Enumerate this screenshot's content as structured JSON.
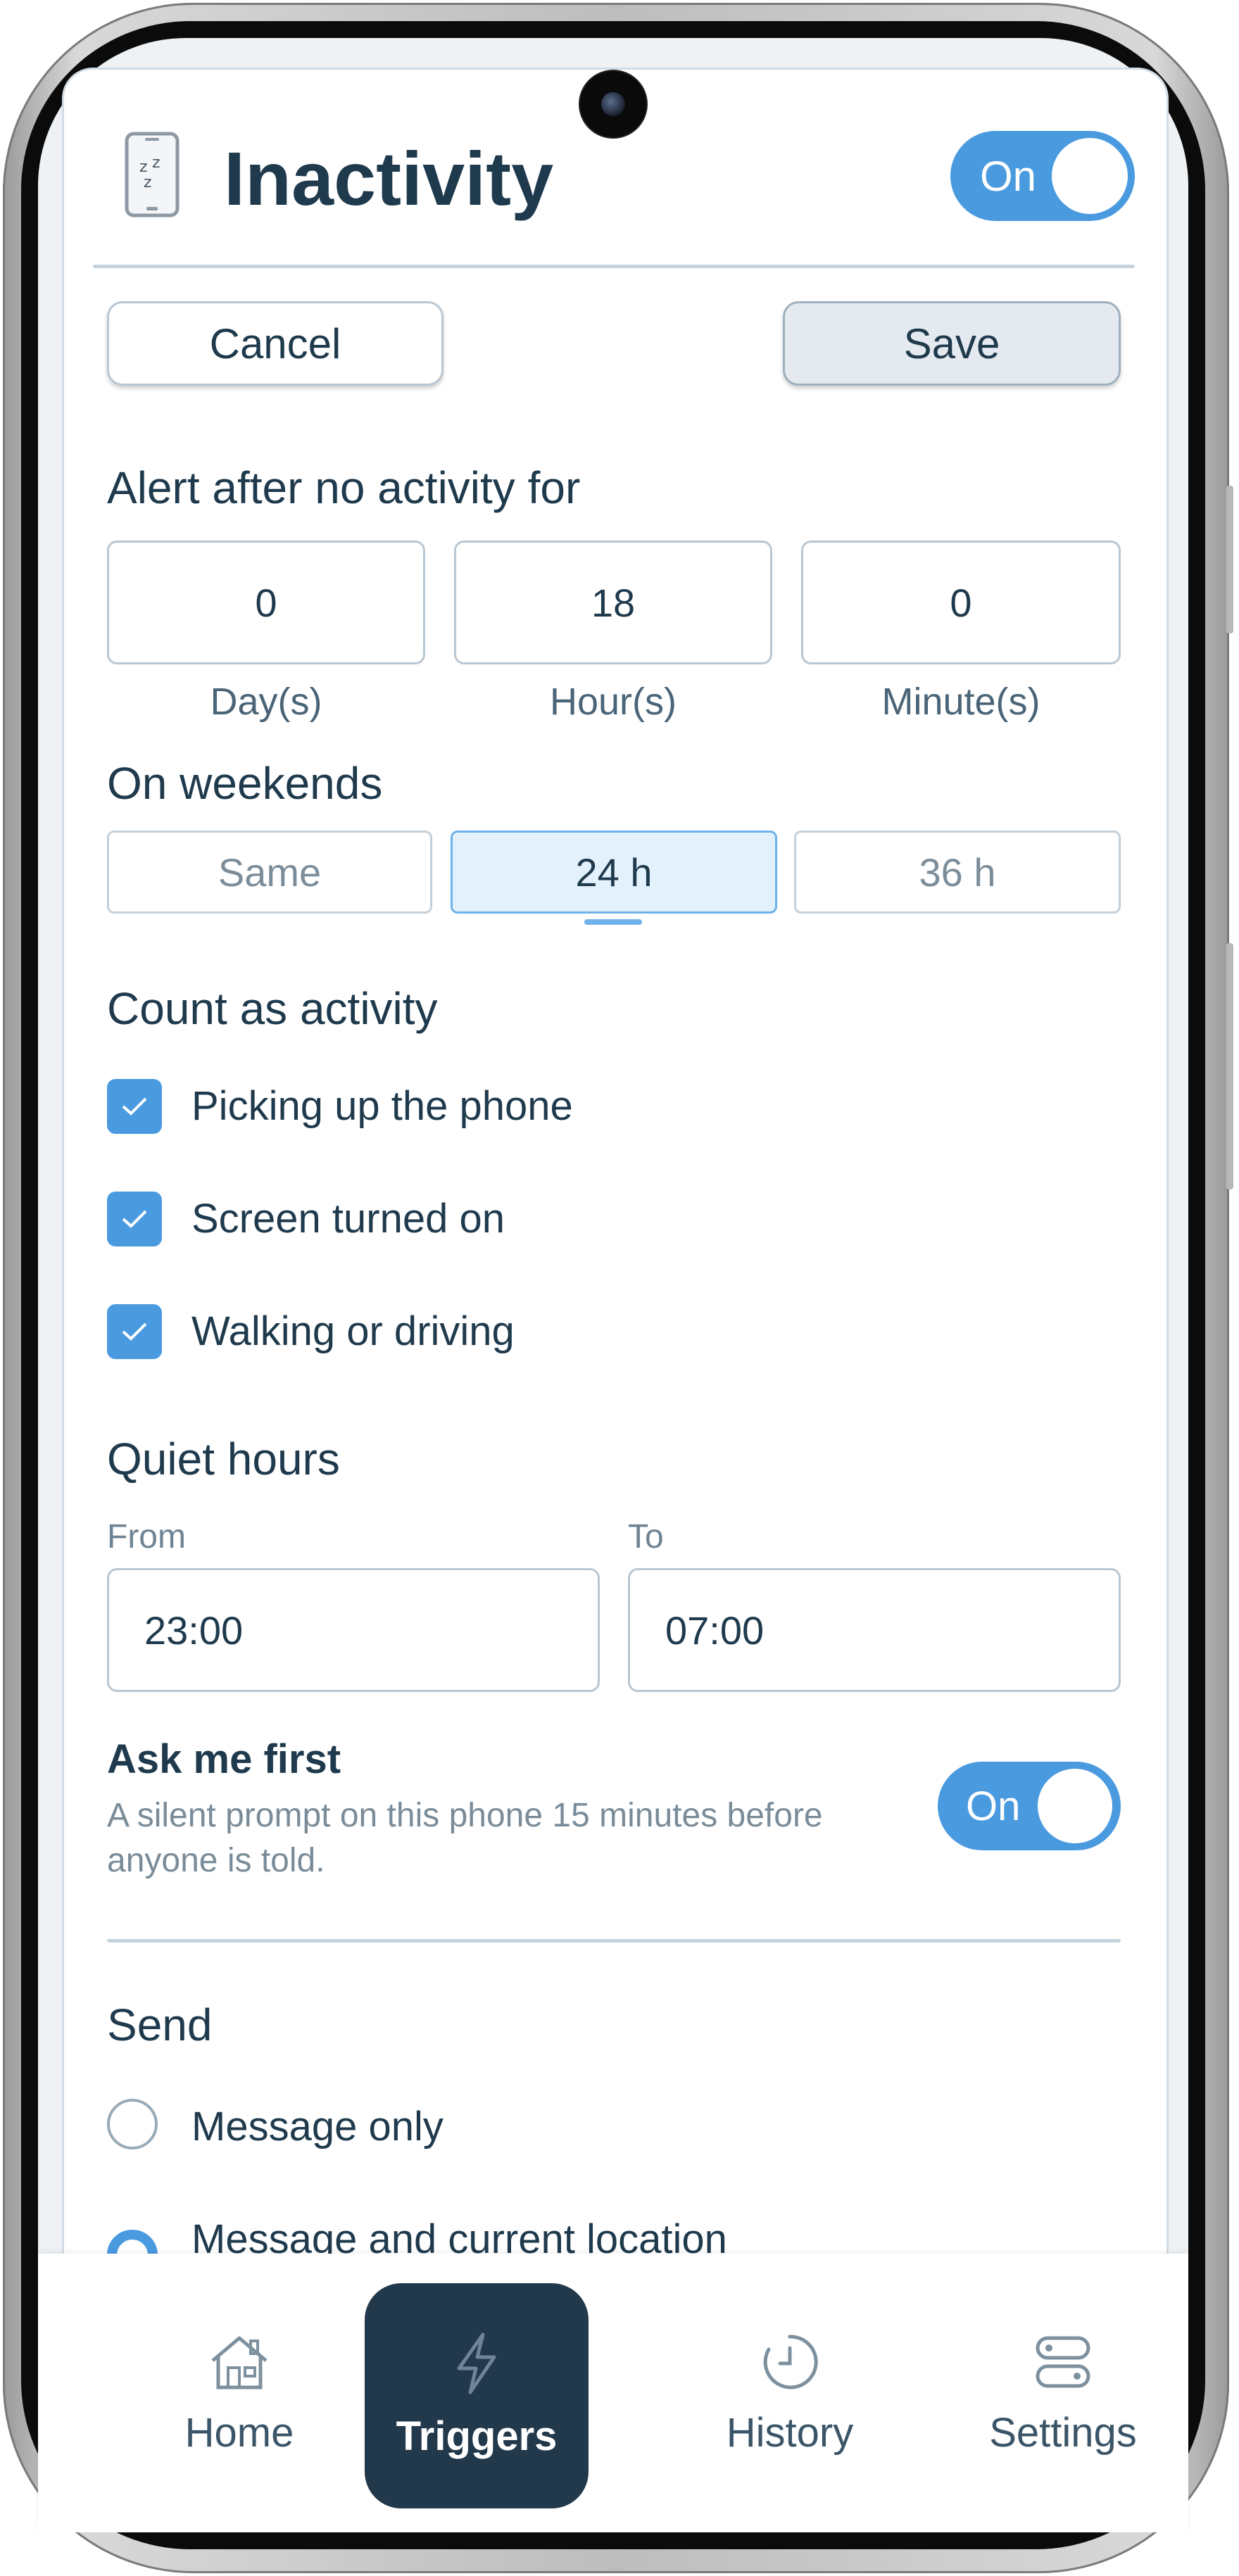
{
  "header": {
    "title": "Inactivity",
    "enabled_label": "On",
    "icon": "sleeping-phone-icon"
  },
  "actions": {
    "cancel_label": "Cancel",
    "save_label": "Save"
  },
  "alert_after": {
    "label": "Alert after no activity for",
    "days": {
      "value": "0",
      "unit": "Day(s)"
    },
    "hours": {
      "value": "18",
      "unit": "Hour(s)"
    },
    "minutes": {
      "value": "0",
      "unit": "Minute(s)"
    }
  },
  "weekends": {
    "label": "On weekends",
    "options": [
      "Same",
      "24 h",
      "36 h"
    ],
    "selected": "24 h"
  },
  "activity": {
    "label": "Count as activity",
    "items": [
      {
        "label": "Picking up the phone",
        "checked": true
      },
      {
        "label": "Screen turned on",
        "checked": true
      },
      {
        "label": "Walking or driving",
        "checked": true
      }
    ]
  },
  "quiet_hours": {
    "label": "Quiet hours",
    "from_label": "From",
    "from_value": "23:00",
    "to_label": "To",
    "to_value": "07:00"
  },
  "ask_first": {
    "label": "Ask me first",
    "description": "A silent prompt on this phone 15 minutes before anyone is told.",
    "toggle_label": "On"
  },
  "send": {
    "label": "Send",
    "options": [
      {
        "label": "Message only",
        "selected": false
      },
      {
        "label": "Message and current location",
        "selected": true
      }
    ]
  },
  "nav": {
    "items": [
      {
        "label": "Home",
        "icon": "home-icon"
      },
      {
        "label": "Triggers",
        "icon": "bolt-icon",
        "active": true
      },
      {
        "label": "History",
        "icon": "clock-icon"
      },
      {
        "label": "Settings",
        "icon": "toggles-icon"
      }
    ]
  },
  "colors": {
    "accent": "#4a9ae0",
    "text": "#1f3a4d",
    "nav_active": "#22384b"
  }
}
